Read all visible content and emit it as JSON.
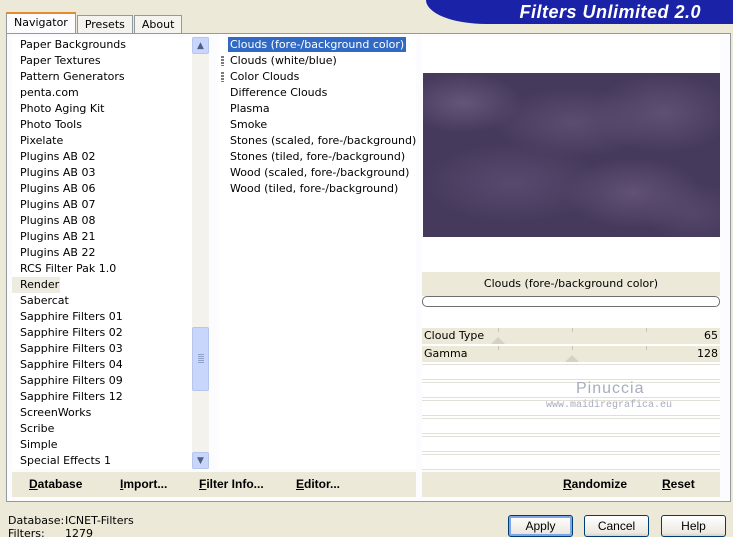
{
  "tabs": [
    {
      "label": "Navigator",
      "active": true
    },
    {
      "label": "Presets",
      "active": false
    },
    {
      "label": "About",
      "active": false
    }
  ],
  "header": {
    "title": "Filters Unlimited 2.0"
  },
  "categories": {
    "items": [
      "Paper Backgrounds",
      "Paper Textures",
      "Pattern Generators",
      "penta.com",
      "Photo Aging Kit",
      "Photo Tools",
      "Pixelate",
      "Plugins AB 02",
      "Plugins AB 03",
      "Plugins AB 06",
      "Plugins AB 07",
      "Plugins AB 08",
      "Plugins AB 21",
      "Plugins AB 22",
      "RCS Filter Pak 1.0",
      "Render",
      "Sabercat",
      "Sapphire Filters 01",
      "Sapphire Filters 02",
      "Sapphire Filters 03",
      "Sapphire Filters 04",
      "Sapphire Filters 09",
      "Sapphire Filters 12",
      "ScreenWorks",
      "Scribe",
      "Simple",
      "Special Effects 1"
    ],
    "selected": "Render"
  },
  "filters": {
    "items": [
      "Clouds (fore-/background color)",
      "Clouds (white/blue)",
      "Color Clouds",
      "Difference Clouds",
      "Plasma",
      "Smoke",
      "Stones (scaled, fore-/background)",
      "Stones (tiled, fore-/background)",
      "Wood (scaled, fore-/background)",
      "Wood (tiled, fore-/background)"
    ],
    "selected": "Clouds (fore-/background color)"
  },
  "preview": {
    "filter_name": "Clouds (fore-/background color)"
  },
  "params": [
    {
      "name": "Cloud Type",
      "value": "65"
    },
    {
      "name": "Gamma",
      "value": "128"
    }
  ],
  "watermark": {
    "line1": "Pinuccia",
    "line2": "www.maidiregrafica.eu"
  },
  "toolbar": {
    "database": "Database",
    "import": "Import...",
    "filter_info": "Filter Info...",
    "editor": "Editor...",
    "randomize": "Randomize",
    "reset": "Reset"
  },
  "status": {
    "database_label": "Database:",
    "database_value": "ICNET-Filters",
    "filters_label": "Filters:",
    "filters_value": "1279"
  },
  "dialog": {
    "apply": "Apply",
    "cancel": "Cancel",
    "help": "Help"
  },
  "colors": {
    "accent": "#316ac5",
    "banner": "#1a23a8",
    "preview_base": "#463a5c"
  }
}
